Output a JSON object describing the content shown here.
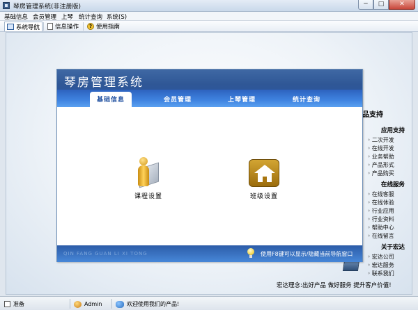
{
  "window": {
    "title": "琴房管理系统(非注册版)",
    "controls": {
      "minimize": "─",
      "maximize": "□",
      "close": "✕"
    }
  },
  "menu": [
    "基础信息",
    "会员管理",
    "上琴",
    "统计查询",
    "系统(S)"
  ],
  "toolbar": {
    "nav_label": "系统导航",
    "info_label": "信息操作",
    "help_label": "使用指南"
  },
  "panel": {
    "title": "琴房管理系统",
    "tabs": [
      "基础信息",
      "会员管理",
      "上琴管理",
      "统计查询"
    ],
    "active_tab": 0,
    "items": [
      {
        "label": "课程设置",
        "icon": "user-icon"
      },
      {
        "label": "班级设置",
        "icon": "house-icon"
      }
    ],
    "pinyin": "QIN FANG GUAN LI XI TONG",
    "hint": "使用F8键可以显示/隐藏当前导航窗口"
  },
  "info": {
    "title": "品支持",
    "sections": [
      {
        "heading": "应用支持",
        "links": [
          "二次开发",
          "在线开发",
          "业务帮助",
          "产品形式",
          "产品购买"
        ]
      },
      {
        "heading": "在线服务",
        "links": [
          "在线客服",
          "在线体验",
          "行业应用",
          "行业资料",
          "帮助中心",
          "在线留言"
        ]
      },
      {
        "heading": "关于宏达",
        "links": [
          "宏达公司",
          "宏达服务",
          "联系我们"
        ]
      }
    ],
    "footer": "宏达理念:出好产品 做好服务 提升客户价值!"
  },
  "status": {
    "ready": "准备",
    "user": "Admin",
    "welcome": "欢迎使用我们的产品!"
  }
}
